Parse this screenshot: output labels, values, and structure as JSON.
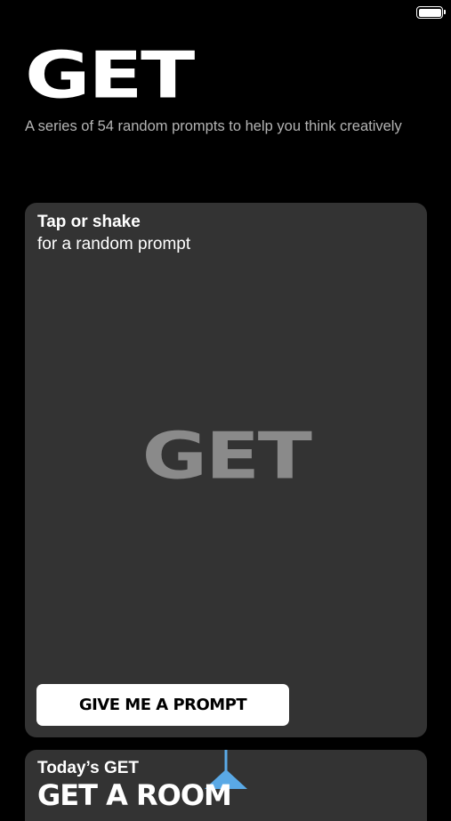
{
  "status_bar": {
    "battery_level": 1.0,
    "icon": "battery-icon"
  },
  "header": {
    "logo_text": "GET",
    "tagline": "A series of 54 random prompts to help you think creatively"
  },
  "prompt_card": {
    "title": "Tap or shake",
    "subtitle": "for a random prompt",
    "logo_text": "GET",
    "button_label": "GIVE ME A PROMPT"
  },
  "today_card": {
    "label": "Today’s GET",
    "prompt": "GET A ROOM",
    "illustration": "hanging-lamp-icon",
    "accent_color": "#5aa9e6"
  },
  "colors": {
    "background": "#000000",
    "card": "#333333",
    "tagline": "#b4b4b4",
    "card_logo": "#8a8a8a",
    "button_bg": "#ffffff",
    "button_text": "#000000"
  }
}
